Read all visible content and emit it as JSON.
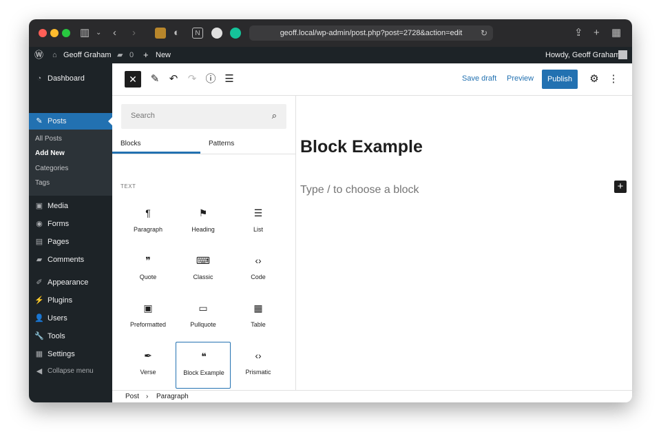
{
  "browser": {
    "url": "geoff.local/wp-admin/post.php?post=2728&action=edit",
    "traffic_colors": [
      "#ff5f57",
      "#febc2e",
      "#28c840"
    ]
  },
  "adminbar": {
    "site_name": "Geoff Graham",
    "comments_count": "0",
    "new_label": "New",
    "howdy": "Howdy, Geoff Graham"
  },
  "sidebar": {
    "dashboard": "Dashboard",
    "posts": "Posts",
    "sub": [
      "All Posts",
      "Add New",
      "Categories",
      "Tags"
    ],
    "media": "Media",
    "forms": "Forms",
    "pages": "Pages",
    "comments": "Comments",
    "appearance": "Appearance",
    "plugins": "Plugins",
    "users": "Users",
    "tools": "Tools",
    "settings": "Settings",
    "collapse": "Collapse menu"
  },
  "toolbar": {
    "save_draft": "Save draft",
    "preview": "Preview",
    "publish": "Publish"
  },
  "inserter": {
    "search_placeholder": "Search",
    "tabs": [
      "Blocks",
      "Patterns"
    ],
    "category": "TEXT",
    "blocks": [
      {
        "label": "Paragraph",
        "icon": "¶"
      },
      {
        "label": "Heading",
        "icon": "⚑"
      },
      {
        "label": "List",
        "icon": "☰"
      },
      {
        "label": "Quote",
        "icon": "❞"
      },
      {
        "label": "Classic",
        "icon": "⌨"
      },
      {
        "label": "Code",
        "icon": "‹›"
      },
      {
        "label": "Preformatted",
        "icon": "▣"
      },
      {
        "label": "Pullquote",
        "icon": "▭"
      },
      {
        "label": "Table",
        "icon": "▦"
      },
      {
        "label": "Verse",
        "icon": "✒"
      },
      {
        "label": "Block Example",
        "icon": "❝"
      },
      {
        "label": "Prismatic",
        "icon": "‹›"
      }
    ]
  },
  "content": {
    "title": "Block Example",
    "placeholder": "Type / to choose a block"
  },
  "footer": {
    "breadcrumb": [
      "Post",
      "Paragraph"
    ]
  }
}
